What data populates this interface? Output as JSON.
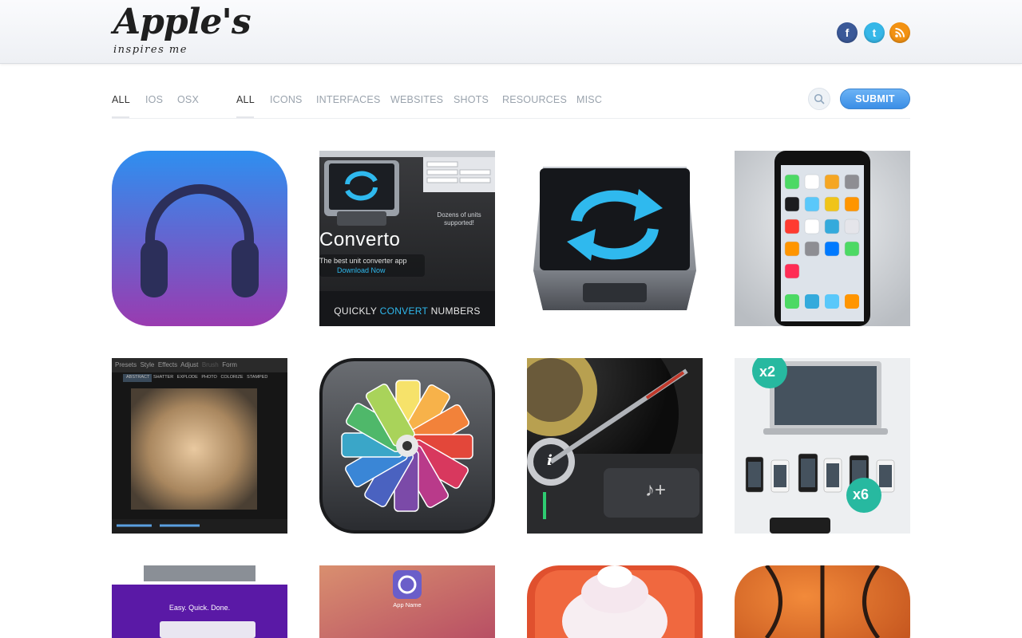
{
  "header": {
    "logo_title": "Apple's",
    "logo_tagline": "inspires me",
    "social": [
      {
        "name": "facebook",
        "glyph": "f"
      },
      {
        "name": "twitter",
        "glyph": "t"
      },
      {
        "name": "rss",
        "glyph": ")"
      }
    ]
  },
  "nav": {
    "platforms": [
      "ALL",
      "IOS",
      "OSX"
    ],
    "categories": [
      "ALL",
      "ICONS",
      "INTERFACES",
      "WEBSITES",
      "SHOTS",
      "RESOURCES",
      "MISC"
    ],
    "active_platform": "ALL",
    "active_category": "ALL",
    "submit_label": "SUBMIT"
  },
  "gallery": {
    "converto": {
      "title": "Converto",
      "tagline": "The best unit converter app",
      "download": "Download Now",
      "note": "Dozens of units supported!",
      "banner_a": "QUICKLY ",
      "banner_b": "CONVERT",
      "banner_c": " NUMBERS"
    },
    "mixer_tabs": [
      "Presets",
      "Style",
      "Effects",
      "Adjust",
      "Brush",
      "Form"
    ],
    "mixer_subtabs": [
      "ABSTRACT",
      "SHATTER",
      "EXPLODE",
      "PHOTO",
      "COLORIZE",
      "STAMPED"
    ],
    "mockup_badges": [
      "x2",
      "x6"
    ],
    "web_tagline": "Easy. Quick. Done.",
    "app_name": "App Name"
  },
  "colors": {
    "accent": "#3a8ee6",
    "facebook": "#3b5998",
    "twitter": "#36b7e8",
    "rss": "#f39212"
  }
}
